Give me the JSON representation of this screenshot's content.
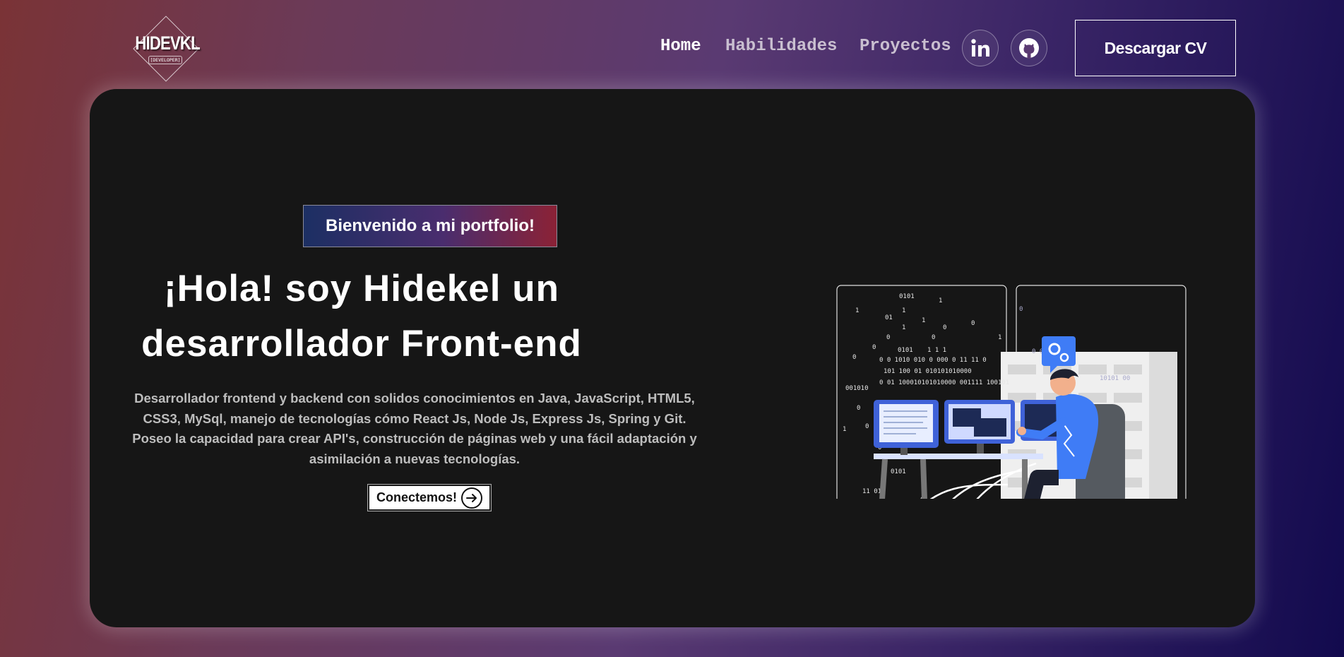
{
  "nav": {
    "logo_text": "HIDEVKL",
    "logo_sub": "[DEVELOPER]",
    "links": [
      "Home",
      "Habilidades",
      "Proyectos"
    ],
    "social": [
      "linkedin-icon",
      "github-icon"
    ],
    "cv_button": "Descargar CV"
  },
  "hero": {
    "tagline": "Bienvenido a mi portfolio!",
    "title_line1": "¡Hola! soy Hidekel un",
    "title_line2": "desarrollador Front-end",
    "desc_line1": "Desarrollador frontend y backend con solidos conocimientos en Java, JavaScript, HTML5,",
    "desc_line2": "CSS3, MySql, manejo de tecnologías cómo React Js, Node Js, Express Js, Spring y Git.",
    "desc_line3": "Poseo la capacidad para crear API's, construcción de páginas web y una fácil adaptación y",
    "desc_line4": "asimilación a nuevas tecnologías.",
    "cta": "Conectemos!",
    "illustration_icon": "developer-at-desk-illustration"
  },
  "colors": {
    "hero_bg": "#161616",
    "accent_blue": "#4a7bf7",
    "tag_gradient_start": "#1c2f63",
    "tag_gradient_end": "#8b2236"
  }
}
